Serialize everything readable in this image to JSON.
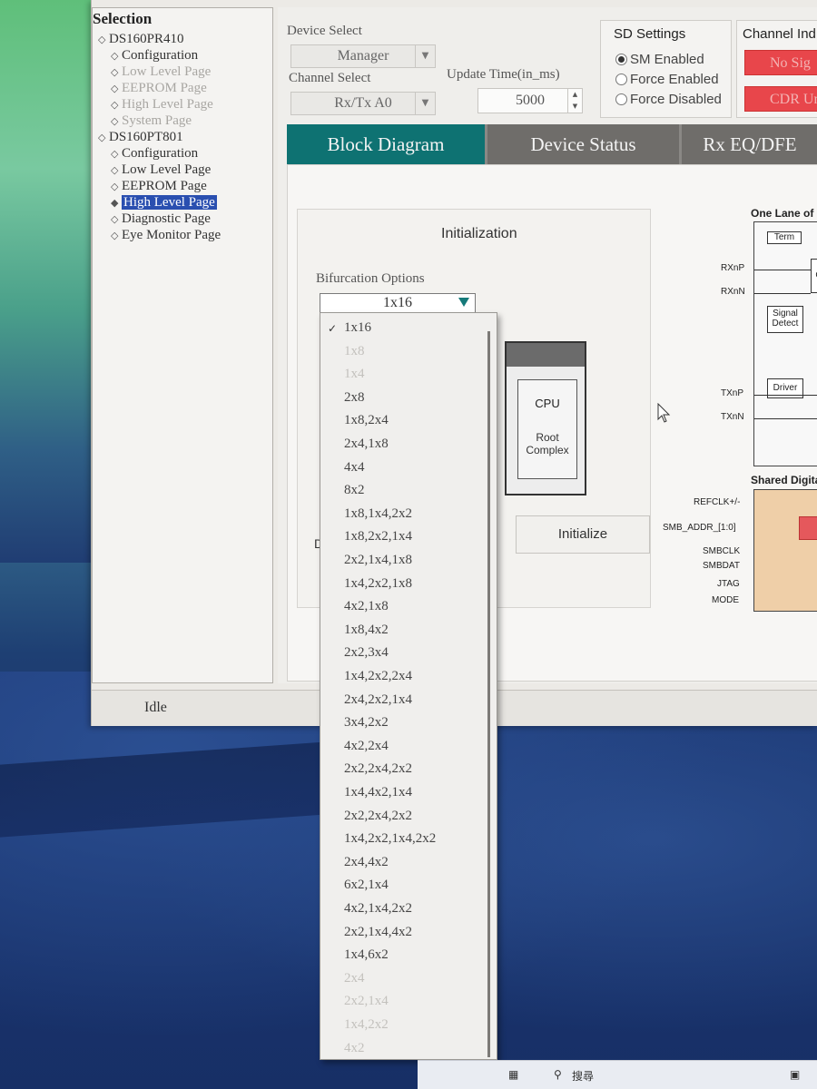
{
  "tree": {
    "title": "Selection",
    "nodes": [
      {
        "label": "DS160PR410",
        "level": 0,
        "state": "normal"
      },
      {
        "label": "Configuration",
        "level": 1,
        "state": "normal"
      },
      {
        "label": "Low Level Page",
        "level": 1,
        "state": "disabled"
      },
      {
        "label": "EEPROM Page",
        "level": 1,
        "state": "disabled"
      },
      {
        "label": "High Level Page",
        "level": 1,
        "state": "disabled"
      },
      {
        "label": "System Page",
        "level": 1,
        "state": "disabled"
      },
      {
        "label": "DS160PT801",
        "level": 0,
        "state": "normal"
      },
      {
        "label": "Configuration",
        "level": 1,
        "state": "normal"
      },
      {
        "label": "Low Level Page",
        "level": 1,
        "state": "normal"
      },
      {
        "label": "EEPROM Page",
        "level": 1,
        "state": "normal"
      },
      {
        "label": "High Level Page",
        "level": 1,
        "state": "selected"
      },
      {
        "label": "Diagnostic Page",
        "level": 1,
        "state": "normal"
      },
      {
        "label": "Eye Monitor Page",
        "level": 1,
        "state": "normal"
      }
    ]
  },
  "status": {
    "text": "Idle"
  },
  "device_select": {
    "label": "Device Select",
    "value": "Manager"
  },
  "channel_select": {
    "label": "Channel Select",
    "value": "Rx/Tx A0"
  },
  "update_time": {
    "label": "Update Time(in_ms)",
    "value": "5000"
  },
  "sd_settings": {
    "title": "SD Settings",
    "options": [
      {
        "label": "SM Enabled",
        "selected": true
      },
      {
        "label": "Force Enabled",
        "selected": false
      },
      {
        "label": "Force Disabled",
        "selected": false
      }
    ]
  },
  "channel_indicators": {
    "title": "Channel Ind",
    "items": [
      "No Sig",
      "CDR Unlo"
    ],
    "color": "#e8464b"
  },
  "tabs": [
    {
      "label": "Block Diagram",
      "active": true
    },
    {
      "label": "Device Status",
      "active": false
    },
    {
      "label": "Rx EQ/DFE",
      "active": false
    }
  ],
  "initialization": {
    "title": "Initialization",
    "bifurcation_label": "Bifurcation Options",
    "bifurcation_value": "1x16",
    "cpu_label": "CPU",
    "root_complex_label": "Root Complex",
    "initialize_button": "Initialize",
    "clipped_label": "D"
  },
  "diagram": {
    "lane_title": "One Lane of",
    "term_label": "Term",
    "signal_detect_label": "Signal Detect",
    "driver_label": "Driver",
    "shared_title": "Shared Digita",
    "pins_rx": [
      "RXnP",
      "RXnN"
    ],
    "pins_tx": [
      "TXnP",
      "TXnN"
    ],
    "pins_shared": [
      "REFCLK+/-",
      "SMB_ADDR_[1:0]",
      "SMBCLK",
      "SMBDAT",
      "JTAG",
      "MODE"
    ],
    "fragment_c": "C"
  },
  "bifurcation_options": [
    {
      "label": "1x16",
      "checked": true,
      "disabled": false
    },
    {
      "label": "1x8",
      "checked": false,
      "disabled": true
    },
    {
      "label": "1x4",
      "checked": false,
      "disabled": true
    },
    {
      "label": "2x8",
      "checked": false,
      "disabled": false
    },
    {
      "label": "1x8,2x4",
      "checked": false,
      "disabled": false
    },
    {
      "label": "2x4,1x8",
      "checked": false,
      "disabled": false
    },
    {
      "label": "4x4",
      "checked": false,
      "disabled": false
    },
    {
      "label": "8x2",
      "checked": false,
      "disabled": false
    },
    {
      "label": "1x8,1x4,2x2",
      "checked": false,
      "disabled": false
    },
    {
      "label": "1x8,2x2,1x4",
      "checked": false,
      "disabled": false
    },
    {
      "label": "2x2,1x4,1x8",
      "checked": false,
      "disabled": false
    },
    {
      "label": "1x4,2x2,1x8",
      "checked": false,
      "disabled": false
    },
    {
      "label": "4x2,1x8",
      "checked": false,
      "disabled": false
    },
    {
      "label": "1x8,4x2",
      "checked": false,
      "disabled": false
    },
    {
      "label": "2x2,3x4",
      "checked": false,
      "disabled": false
    },
    {
      "label": "1x4,2x2,2x4",
      "checked": false,
      "disabled": false
    },
    {
      "label": "2x4,2x2,1x4",
      "checked": false,
      "disabled": false
    },
    {
      "label": "3x4,2x2",
      "checked": false,
      "disabled": false
    },
    {
      "label": "4x2,2x4",
      "checked": false,
      "disabled": false
    },
    {
      "label": "2x2,2x4,2x2",
      "checked": false,
      "disabled": false
    },
    {
      "label": "1x4,4x2,1x4",
      "checked": false,
      "disabled": false
    },
    {
      "label": "2x2,2x4,2x2",
      "checked": false,
      "disabled": false
    },
    {
      "label": "1x4,2x2,1x4,2x2",
      "checked": false,
      "disabled": false
    },
    {
      "label": "2x4,4x2",
      "checked": false,
      "disabled": false
    },
    {
      "label": "6x2,1x4",
      "checked": false,
      "disabled": false
    },
    {
      "label": "4x2,1x4,2x2",
      "checked": false,
      "disabled": false
    },
    {
      "label": "2x2,1x4,4x2",
      "checked": false,
      "disabled": false
    },
    {
      "label": "1x4,6x2",
      "checked": false,
      "disabled": false
    },
    {
      "label": "2x4",
      "checked": false,
      "disabled": true
    },
    {
      "label": "2x2,1x4",
      "checked": false,
      "disabled": true
    },
    {
      "label": "1x4,2x2",
      "checked": false,
      "disabled": true
    },
    {
      "label": "4x2",
      "checked": false,
      "disabled": true
    }
  ],
  "taskbar": {
    "search_text": "搜尋"
  }
}
